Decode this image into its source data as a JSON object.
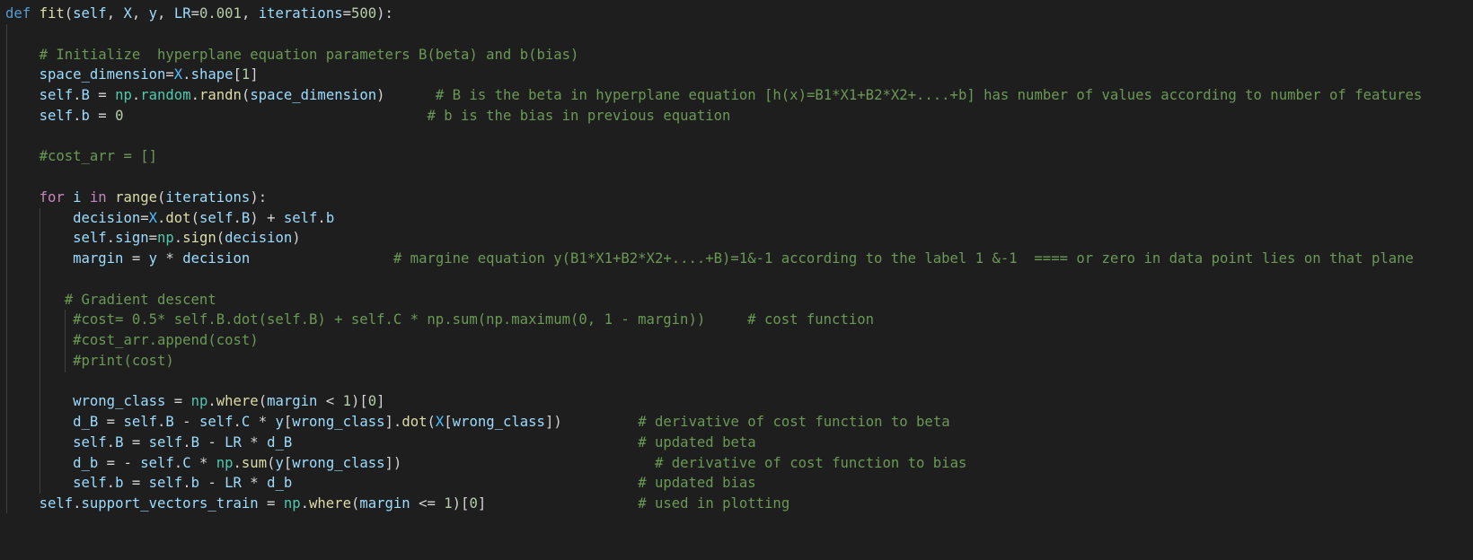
{
  "editor": {
    "background": "#1e1e1e",
    "lines": [
      [
        [
          "k",
          "def "
        ],
        [
          "f",
          "fit"
        ],
        [
          "p",
          "("
        ],
        [
          "v",
          "self"
        ],
        [
          "p",
          ", "
        ],
        [
          "v",
          "X"
        ],
        [
          "p",
          ", "
        ],
        [
          "v",
          "y"
        ],
        [
          "p",
          ", "
        ],
        [
          "v",
          "LR"
        ],
        [
          "p",
          "="
        ],
        [
          "n",
          "0.001"
        ],
        [
          "p",
          ", "
        ],
        [
          "v",
          "iterations"
        ],
        [
          "p",
          "="
        ],
        [
          "n",
          "500"
        ],
        [
          "p",
          "):"
        ]
      ],
      [],
      [
        [
          "p",
          "    "
        ],
        [
          "c",
          "# Initialize  hyperplane equation parameters B(beta) and b(bias)"
        ]
      ],
      [
        [
          "p",
          "    "
        ],
        [
          "v",
          "space_dimension"
        ],
        [
          "p",
          "="
        ],
        [
          "C",
          "X"
        ],
        [
          "p",
          "."
        ],
        [
          "v",
          "shape"
        ],
        [
          "p",
          "["
        ],
        [
          "n",
          "1"
        ],
        [
          "p",
          "]"
        ]
      ],
      [
        [
          "p",
          "    "
        ],
        [
          "v",
          "self"
        ],
        [
          "p",
          "."
        ],
        [
          "v",
          "B"
        ],
        [
          "p",
          " = "
        ],
        [
          "m",
          "np"
        ],
        [
          "p",
          "."
        ],
        [
          "m",
          "random"
        ],
        [
          "p",
          "."
        ],
        [
          "f",
          "randn"
        ],
        [
          "p",
          "("
        ],
        [
          "v",
          "space_dimension"
        ],
        [
          "p",
          ")      "
        ],
        [
          "c",
          "# B is the beta in hyperplane equation [h(x)=B1*X1+B2*X2+....+b] has number of values according to number of features"
        ]
      ],
      [
        [
          "p",
          "    "
        ],
        [
          "v",
          "self"
        ],
        [
          "p",
          "."
        ],
        [
          "v",
          "b"
        ],
        [
          "p",
          " = "
        ],
        [
          "n",
          "0"
        ],
        [
          "p",
          "                                    "
        ],
        [
          "c",
          "# b is the bias in previous equation"
        ]
      ],
      [],
      [
        [
          "p",
          "    "
        ],
        [
          "c",
          "#cost_arr = []"
        ]
      ],
      [],
      [
        [
          "p",
          "    "
        ],
        [
          "kc",
          "for"
        ],
        [
          "p",
          " "
        ],
        [
          "v",
          "i"
        ],
        [
          "p",
          " "
        ],
        [
          "kc",
          "in"
        ],
        [
          "p",
          " "
        ],
        [
          "f",
          "range"
        ],
        [
          "p",
          "("
        ],
        [
          "v",
          "iterations"
        ],
        [
          "p",
          "):"
        ]
      ],
      [
        [
          "p",
          "        "
        ],
        [
          "v",
          "decision"
        ],
        [
          "p",
          "="
        ],
        [
          "C",
          "X"
        ],
        [
          "p",
          "."
        ],
        [
          "f",
          "dot"
        ],
        [
          "p",
          "("
        ],
        [
          "v",
          "self"
        ],
        [
          "p",
          "."
        ],
        [
          "v",
          "B"
        ],
        [
          "p",
          ") + "
        ],
        [
          "v",
          "self"
        ],
        [
          "p",
          "."
        ],
        [
          "v",
          "b"
        ]
      ],
      [
        [
          "p",
          "        "
        ],
        [
          "v",
          "self"
        ],
        [
          "p",
          "."
        ],
        [
          "v",
          "sign"
        ],
        [
          "p",
          "="
        ],
        [
          "m",
          "np"
        ],
        [
          "p",
          "."
        ],
        [
          "f",
          "sign"
        ],
        [
          "p",
          "("
        ],
        [
          "v",
          "decision"
        ],
        [
          "p",
          ")"
        ]
      ],
      [
        [
          "p",
          "        "
        ],
        [
          "v",
          "margin"
        ],
        [
          "p",
          " = "
        ],
        [
          "v",
          "y"
        ],
        [
          "p",
          " * "
        ],
        [
          "v",
          "decision"
        ],
        [
          "p",
          "                 "
        ],
        [
          "c",
          "# margine equation y(B1*X1+B2*X2+....+B)=1&-1 according to the label 1 &-1  ==== or zero in data point lies on that plane"
        ]
      ],
      [],
      [
        [
          "p",
          "       "
        ],
        [
          "c",
          "# Gradient descent"
        ]
      ],
      [
        [
          "p",
          "        "
        ],
        [
          "c",
          "#cost= 0.5* self.B.dot(self.B) + self.C * np.sum(np.maximum(0, 1 - margin))     # cost function"
        ]
      ],
      [
        [
          "p",
          "        "
        ],
        [
          "c",
          "#cost_arr.append(cost)"
        ]
      ],
      [
        [
          "p",
          "        "
        ],
        [
          "c",
          "#print(cost)"
        ]
      ],
      [],
      [
        [
          "p",
          "        "
        ],
        [
          "v",
          "wrong_class"
        ],
        [
          "p",
          " = "
        ],
        [
          "m",
          "np"
        ],
        [
          "p",
          "."
        ],
        [
          "f",
          "where"
        ],
        [
          "p",
          "("
        ],
        [
          "v",
          "margin"
        ],
        [
          "p",
          " < "
        ],
        [
          "n",
          "1"
        ],
        [
          "p",
          ")["
        ],
        [
          "n",
          "0"
        ],
        [
          "p",
          "]"
        ]
      ],
      [
        [
          "p",
          "        "
        ],
        [
          "v",
          "d_B"
        ],
        [
          "p",
          " = "
        ],
        [
          "v",
          "self"
        ],
        [
          "p",
          "."
        ],
        [
          "v",
          "B"
        ],
        [
          "p",
          " - "
        ],
        [
          "v",
          "self"
        ],
        [
          "p",
          "."
        ],
        [
          "v",
          "C"
        ],
        [
          "p",
          " * "
        ],
        [
          "v",
          "y"
        ],
        [
          "p",
          "["
        ],
        [
          "v",
          "wrong_class"
        ],
        [
          "p",
          "]."
        ],
        [
          "f",
          "dot"
        ],
        [
          "p",
          "("
        ],
        [
          "C",
          "X"
        ],
        [
          "p",
          "["
        ],
        [
          "v",
          "wrong_class"
        ],
        [
          "p",
          "])         "
        ],
        [
          "c",
          "# derivative of cost function to beta"
        ]
      ],
      [
        [
          "p",
          "        "
        ],
        [
          "v",
          "self"
        ],
        [
          "p",
          "."
        ],
        [
          "v",
          "B"
        ],
        [
          "p",
          " = "
        ],
        [
          "v",
          "self"
        ],
        [
          "p",
          "."
        ],
        [
          "v",
          "B"
        ],
        [
          "p",
          " - "
        ],
        [
          "v",
          "LR"
        ],
        [
          "p",
          " * "
        ],
        [
          "v",
          "d_B"
        ],
        [
          "p",
          "                                         "
        ],
        [
          "c",
          "# updated beta"
        ]
      ],
      [
        [
          "p",
          "        "
        ],
        [
          "v",
          "d_b"
        ],
        [
          "p",
          " = - "
        ],
        [
          "v",
          "self"
        ],
        [
          "p",
          "."
        ],
        [
          "v",
          "C"
        ],
        [
          "p",
          " * "
        ],
        [
          "m",
          "np"
        ],
        [
          "p",
          "."
        ],
        [
          "f",
          "sum"
        ],
        [
          "p",
          "("
        ],
        [
          "v",
          "y"
        ],
        [
          "p",
          "["
        ],
        [
          "v",
          "wrong_class"
        ],
        [
          "p",
          "])                              "
        ],
        [
          "c",
          "# derivative of cost function to bias"
        ]
      ],
      [
        [
          "p",
          "        "
        ],
        [
          "v",
          "self"
        ],
        [
          "p",
          "."
        ],
        [
          "v",
          "b"
        ],
        [
          "p",
          " = "
        ],
        [
          "v",
          "self"
        ],
        [
          "p",
          "."
        ],
        [
          "v",
          "b"
        ],
        [
          "p",
          " - "
        ],
        [
          "v",
          "LR"
        ],
        [
          "p",
          " * "
        ],
        [
          "v",
          "d_b"
        ],
        [
          "p",
          "                                         "
        ],
        [
          "c",
          "# updated bias"
        ]
      ],
      [
        [
          "p",
          "    "
        ],
        [
          "v",
          "self"
        ],
        [
          "p",
          "."
        ],
        [
          "v",
          "support_vectors_train"
        ],
        [
          "p",
          " = "
        ],
        [
          "m",
          "np"
        ],
        [
          "p",
          "."
        ],
        [
          "f",
          "where"
        ],
        [
          "p",
          "("
        ],
        [
          "v",
          "margin"
        ],
        [
          "p",
          " <= "
        ],
        [
          "n",
          "1"
        ],
        [
          "p",
          ")["
        ],
        [
          "n",
          "0"
        ],
        [
          "p",
          "]                  "
        ],
        [
          "c",
          "# used in plotting"
        ]
      ]
    ]
  }
}
